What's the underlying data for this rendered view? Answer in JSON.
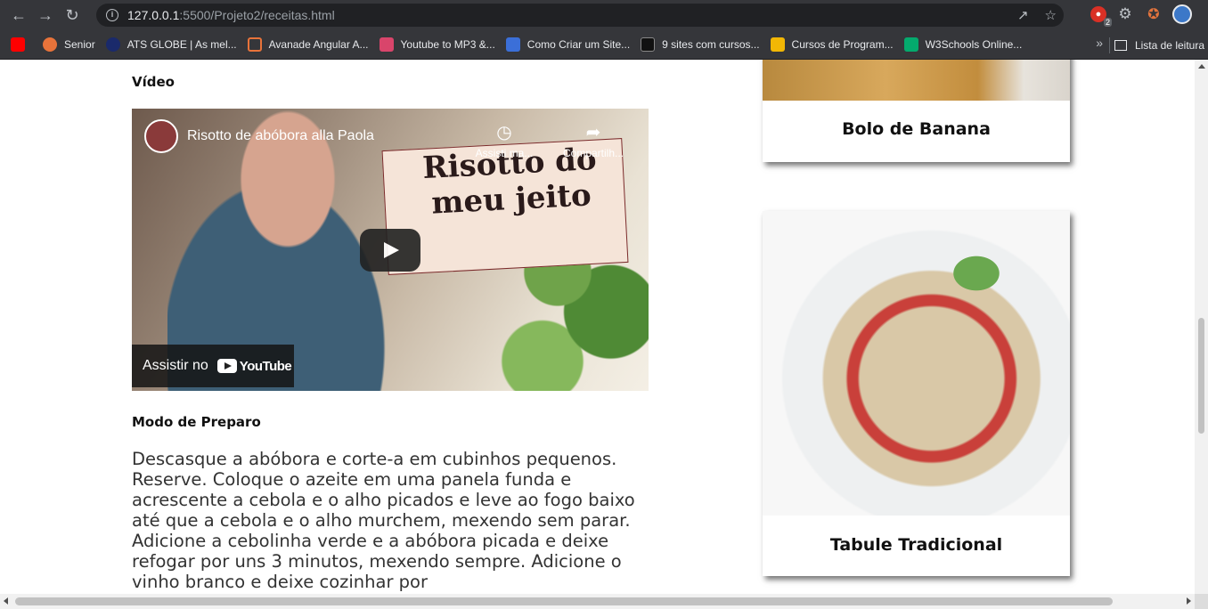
{
  "browser": {
    "url_host": "127.0.0.1",
    "url_rest": ":5500/Projeto2/receitas.html",
    "extension_badge": "2",
    "bookmarks": [
      {
        "label": "",
        "color": "#ff0000"
      },
      {
        "label": "Senior",
        "color": "#e8733a"
      },
      {
        "label": "ATS GLOBE | As mel...",
        "color": "#1a2a6b"
      },
      {
        "label": "Avanade Angular A...",
        "color": "#e8733a"
      },
      {
        "label": "Youtube to MP3 &...",
        "color": "#d9456b"
      },
      {
        "label": "Como Criar um Site...",
        "color": "#3b6fd8"
      },
      {
        "label": "9 sites com cursos...",
        "color": "#111111"
      },
      {
        "label": "Cursos de Program...",
        "color": "#f2b705"
      },
      {
        "label": "W3Schools Online...",
        "color": "#04aa6d"
      }
    ],
    "reading_list": "Lista de leitura"
  },
  "recipe": {
    "video_label": "Vídeo",
    "video": {
      "title": "Risotto de abóbora alla Paola",
      "watch_later": "Assisti ma...",
      "share": "Compartilh...",
      "thumbnail_text": "Risotto do meu jeito",
      "watch_on": "Assistir no",
      "youtube_label": "YouTube"
    },
    "prep_label": "Modo de Preparo",
    "prep_text": "Descasque a abóbora e corte-a em cubinhos pequenos. Reserve. Coloque o azeite em uma panela funda e acrescente a cebola e o alho picados e leve ao fogo baixo até que a cebola e o alho murchem, mexendo sem parar. Adicione a cebolinha verde e a abóbora picada e deixe refogar por uns 3 minutos, mexendo sempre. Adicione o vinho branco e deixe cozinhar por"
  },
  "sidebar": {
    "cards": [
      {
        "title": "Bolo de Banana"
      },
      {
        "title": "Tabule Tradicional"
      }
    ]
  }
}
